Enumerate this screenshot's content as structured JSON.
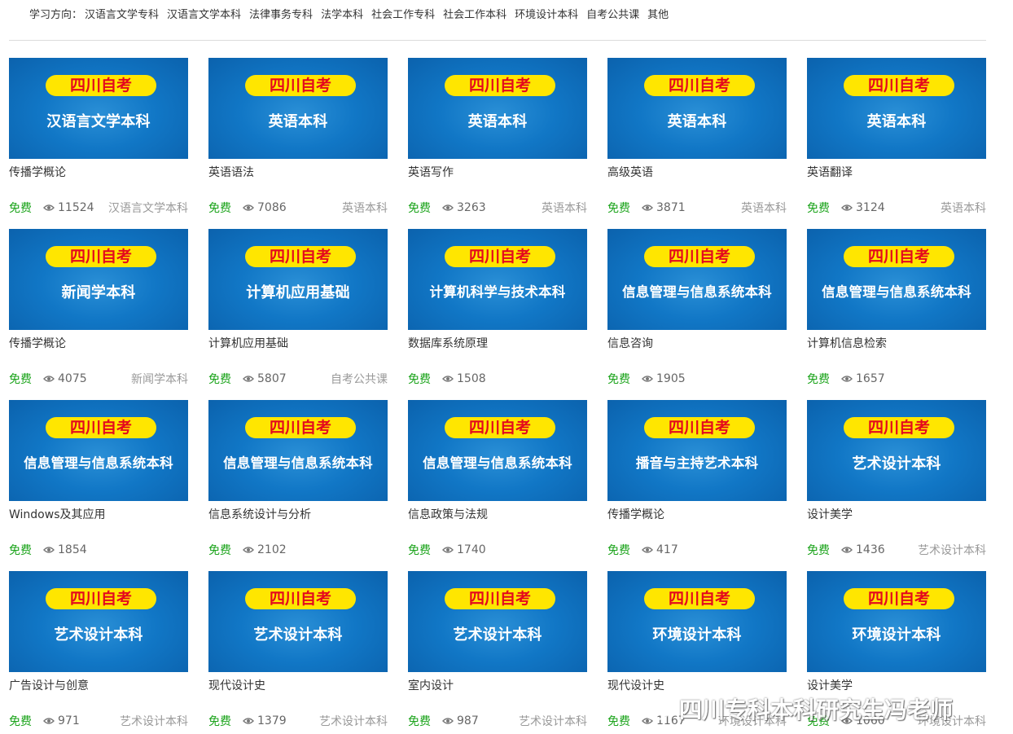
{
  "filter": {
    "label": "学习方向：",
    "items": [
      "汉语言文学专科",
      "汉语言文学本科",
      "法律事务专科",
      "法学本科",
      "社会工作专科",
      "社会工作本科",
      "环境设计本科",
      "自考公共课",
      "其他"
    ]
  },
  "banner_text": "四川自考",
  "free_label": "免费",
  "colors": {
    "banner_bg": "#ffe600",
    "banner_text": "#e4081d",
    "thumb_bg": "#1177c6",
    "free": "#1aa31a"
  },
  "courses": [
    {
      "subject": "汉语言文学本科",
      "title": "传播学概论",
      "views": "11524",
      "category": "汉语言文学本科"
    },
    {
      "subject": "英语本科",
      "title": "英语语法",
      "views": "7086",
      "category": "英语本科"
    },
    {
      "subject": "英语本科",
      "title": "英语写作",
      "views": "3263",
      "category": "英语本科"
    },
    {
      "subject": "英语本科",
      "title": "高级英语",
      "views": "3871",
      "category": "英语本科"
    },
    {
      "subject": "英语本科",
      "title": "英语翻译",
      "views": "3124",
      "category": "英语本科"
    },
    {
      "subject": "新闻学本科",
      "title": "传播学概论",
      "views": "4075",
      "category": "新闻学本科"
    },
    {
      "subject": "计算机应用基础",
      "title": "计算机应用基础",
      "views": "5807",
      "category": "自考公共课"
    },
    {
      "subject": "计算机科学与技术本科",
      "title": "数据库系统原理",
      "views": "1508",
      "category": ""
    },
    {
      "subject": "信息管理与信息系统本科",
      "title": "信息咨询",
      "views": "1905",
      "category": ""
    },
    {
      "subject": "信息管理与信息系统本科",
      "title": "计算机信息检索",
      "views": "1657",
      "category": ""
    },
    {
      "subject": "信息管理与信息系统本科",
      "title": "Windows及其应用",
      "views": "1854",
      "category": ""
    },
    {
      "subject": "信息管理与信息系统本科",
      "title": "信息系统设计与分析",
      "views": "2102",
      "category": ""
    },
    {
      "subject": "信息管理与信息系统本科",
      "title": "信息政策与法规",
      "views": "1740",
      "category": ""
    },
    {
      "subject": "播音与主持艺术本科",
      "title": "传播学概论",
      "views": "417",
      "category": ""
    },
    {
      "subject": "艺术设计本科",
      "title": "设计美学",
      "views": "1436",
      "category": "艺术设计本科"
    },
    {
      "subject": "艺术设计本科",
      "title": "广告设计与创意",
      "views": "971",
      "category": "艺术设计本科"
    },
    {
      "subject": "艺术设计本科",
      "title": "现代设计史",
      "views": "1379",
      "category": "艺术设计本科"
    },
    {
      "subject": "艺术设计本科",
      "title": "室内设计",
      "views": "987",
      "category": "艺术设计本科"
    },
    {
      "subject": "环境设计本科",
      "title": "现代设计史",
      "views": "1167",
      "category": "环境设计本科"
    },
    {
      "subject": "环境设计本科",
      "title": "设计美学",
      "views": "1060",
      "category": "环境设计本科"
    }
  ],
  "watermark": "四川专科本科研究生冯老师"
}
